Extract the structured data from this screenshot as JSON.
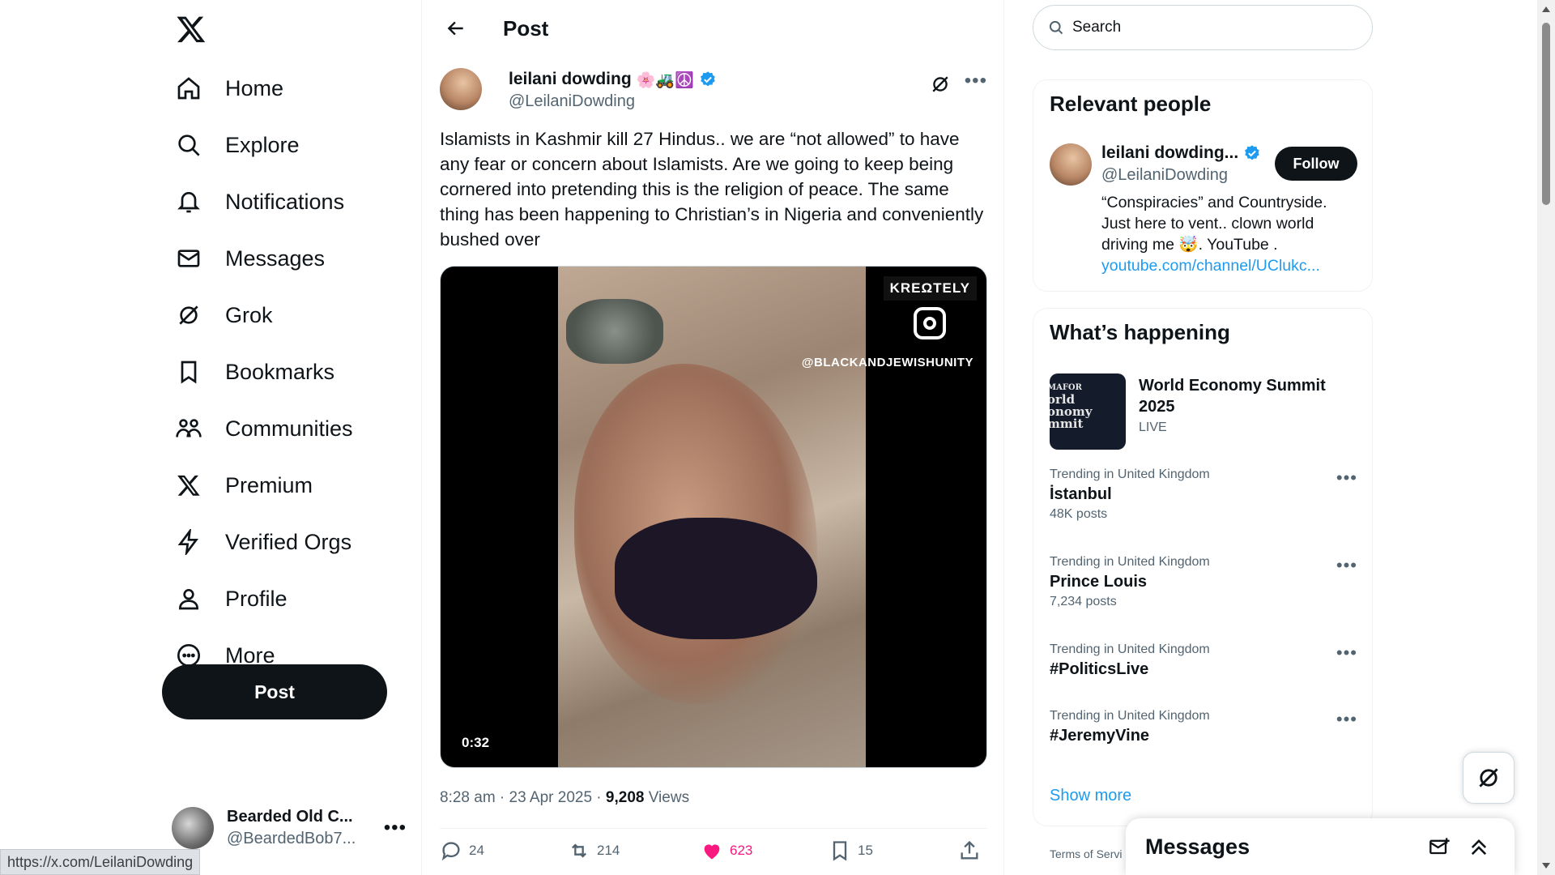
{
  "nav": {
    "items": [
      {
        "label": "Home",
        "icon": "home-icon"
      },
      {
        "label": "Explore",
        "icon": "search-icon"
      },
      {
        "label": "Notifications",
        "icon": "bell-icon"
      },
      {
        "label": "Messages",
        "icon": "envelope-icon"
      },
      {
        "label": "Grok",
        "icon": "grok-icon"
      },
      {
        "label": "Bookmarks",
        "icon": "bookmark-icon"
      },
      {
        "label": "Communities",
        "icon": "communities-icon"
      },
      {
        "label": "Premium",
        "icon": "x-logo-icon"
      },
      {
        "label": "Verified Orgs",
        "icon": "lightning-icon"
      },
      {
        "label": "Profile",
        "icon": "person-icon"
      },
      {
        "label": "More",
        "icon": "more-circle-icon"
      }
    ],
    "post_label": "Post"
  },
  "account": {
    "name": "Bearded Old C...",
    "handle": "@BeardedBob7..."
  },
  "status_url": "https://x.com/LeilaniDowding",
  "header": {
    "title": "Post"
  },
  "tweet": {
    "author_name": "leilani dowding",
    "author_emoji": "🌸🚜☮️",
    "author_handle": "@LeilaniDowding",
    "text": "Islamists in Kashmir kill 27 Hindus..  we are “not allowed” to have any fear or concern about Islamists.  Are we going to keep being cornered into pretending this is the religion of peace. The same thing has been happening to Christian’s in Nigeria and conveniently bushed over",
    "media": {
      "watermark": "KREΩTELY",
      "ig_handle": "@BLACKANDJEWISHUNITY",
      "duration": "0:32"
    },
    "time": "8:28 am · 23 Apr 2025 · ",
    "views_count": "9,208",
    "views_label": " Views",
    "replies": "24",
    "reposts": "214",
    "likes": "623",
    "bookmarks": "15"
  },
  "search": {
    "placeholder": "Search"
  },
  "relevant_people": {
    "title": "Relevant people",
    "name": "leilani dowding...",
    "handle": "@LeilaniDowding",
    "follow_label": "Follow",
    "bio": "“Conspiracies” and Countryside. Just here to vent.. clown world driving me 🤯. YouTube .",
    "bio_link": "youtube.com/channel/UClukc..."
  },
  "happening": {
    "title": "What’s happening",
    "event": {
      "title": "World Economy Summit 2025",
      "status": "LIVE",
      "thumb_lines": [
        "MAFOR",
        "orld",
        "onomy",
        "mmit"
      ]
    },
    "trends": [
      {
        "context": "Trending in United Kingdom",
        "title": "İstanbul",
        "count": "48K posts"
      },
      {
        "context": "Trending in United Kingdom",
        "title": "Prince Louis",
        "count": "7,234 posts"
      },
      {
        "context": "Trending in United Kingdom",
        "title": "#PoliticsLive",
        "count": ""
      },
      {
        "context": "Trending in United Kingdom",
        "title": "#JeremyVine",
        "count": ""
      }
    ],
    "show_more": "Show more"
  },
  "footer": {
    "terms": "Terms of Servi"
  },
  "messages_drawer": {
    "title": "Messages"
  },
  "colors": {
    "accent": "#1d9bf0",
    "like": "#f91880",
    "text": "#0f1419",
    "muted": "#536471"
  }
}
